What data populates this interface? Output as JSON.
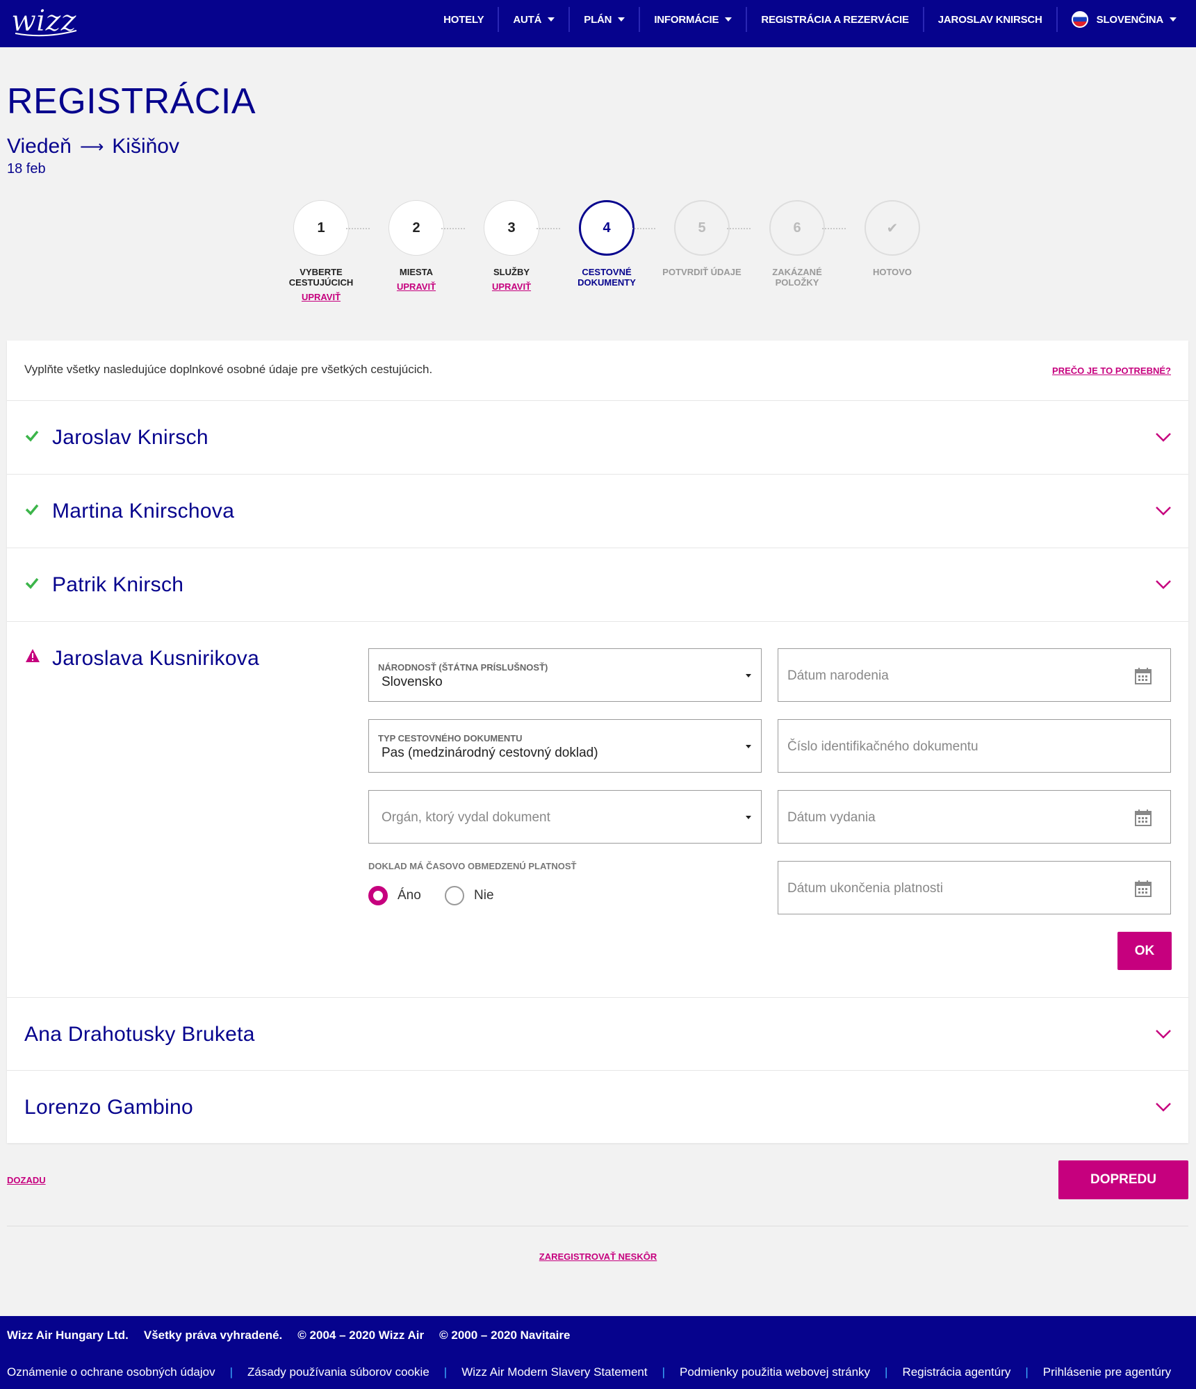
{
  "nav": {
    "logo_text": "wizz",
    "hotels": "HOTELY",
    "cars": "AUTÁ",
    "plan": "PLÁN",
    "info": "INFORMÁCIE",
    "checkin": "REGISTRÁCIA A REZERVÁCIE",
    "user": "JAROSLAV KNIRSCH",
    "language": "SLOVENČINA"
  },
  "header": {
    "title": "REGISTRÁCIA",
    "origin": "Viedeň",
    "arrow": "⟶",
    "destination": "Kišiňov",
    "date": "18 feb"
  },
  "steps": [
    {
      "number": "1",
      "label_line1": "VYBERTE",
      "label_line2": "CESTUJÚCICH",
      "edit": "UPRAVIŤ"
    },
    {
      "number": "2",
      "label_line1": "MIESTA",
      "label_line2": "",
      "edit": "UPRAVIŤ"
    },
    {
      "number": "3",
      "label_line1": "SLUŽBY",
      "label_line2": "",
      "edit": "UPRAVIŤ"
    },
    {
      "number": "4",
      "label_line1": "CESTOVNÉ",
      "label_line2": "DOKUMENTY",
      "edit": ""
    },
    {
      "number": "5",
      "label_line1": "POTVRDIŤ ÚDAJE",
      "label_line2": "",
      "edit": ""
    },
    {
      "number": "6",
      "label_line1": "ZAKÁZANÉ",
      "label_line2": "POLOŽKY",
      "edit": ""
    },
    {
      "number": "✔",
      "label_line1": "HOTOVO",
      "label_line2": "",
      "edit": ""
    }
  ],
  "card": {
    "intro": "Vyplňte všetky nasledujúce doplnkové osobné údaje pre všetkých cestujúcich.",
    "why_link": "PREČO JE TO POTREBNÉ?"
  },
  "passengers": [
    {
      "name": "Jaroslav Knirsch",
      "status": "complete"
    },
    {
      "name": "Martina Knirschova",
      "status": "complete"
    },
    {
      "name": "Patrik Knirsch",
      "status": "complete"
    },
    {
      "name": "Jaroslava Kusnirikova",
      "status": "incomplete"
    },
    {
      "name": "Ana Drahotusky Bruketa",
      "status": "none"
    },
    {
      "name": "Lorenzo Gambino",
      "status": "none"
    }
  ],
  "form": {
    "nationality_label": "NÁRODNOSŤ (ŠTÁTNA PRÍSLUŠNOSŤ)",
    "nationality_value": "Slovensko",
    "doc_type_label": "TYP CESTOVNÉHO DOKUMENTU",
    "doc_type_value": "Pas (medzinárodný cestovný doklad)",
    "issuer_placeholder": "Orgán, ktorý vydal dokument",
    "birth_date_placeholder": "Dátum narodenia",
    "doc_number_placeholder": "Číslo identifikačného dokumentu",
    "issue_date_placeholder": "Dátum vydania",
    "expiry_date_placeholder": "Dátum ukončenia platnosti",
    "limited_validity_label": "DOKLAD MÁ ČASOVO OBMEDZENÚ PLATNOSŤ",
    "yes": "Áno",
    "no": "Nie",
    "ok": "OK"
  },
  "actions": {
    "back": "DOZADU",
    "next": "DOPREDU",
    "later": "ZAREGISTROVAŤ NESKÔR"
  },
  "footer": {
    "company": "Wizz Air Hungary Ltd.",
    "rights": "Všetky práva vyhradené.",
    "copy1": "© 2004 – 2020 Wizz Air",
    "copy2": "© 2000 – 2020 Navitaire",
    "links": [
      "Oznámenie o ochrane osobných údajov",
      "Zásady používania súborov cookie",
      "Wizz Air Modern Slavery Statement",
      "Podmienky použitia webovej stránky",
      "Registrácia agentúry",
      "Prihlásenie pre agentúry"
    ]
  },
  "colors": {
    "brand_navy": "#06038d",
    "brand_magenta": "#c6007e",
    "success_green": "#3cb54a",
    "footer_separator": "#3cb0ff"
  },
  "icons": {
    "logo": "wizz-logo",
    "check": "check-icon",
    "warning": "warning-icon",
    "chevron": "chevron-down-icon",
    "calendar": "calendar-icon",
    "flag": "flag-sk-icon"
  }
}
